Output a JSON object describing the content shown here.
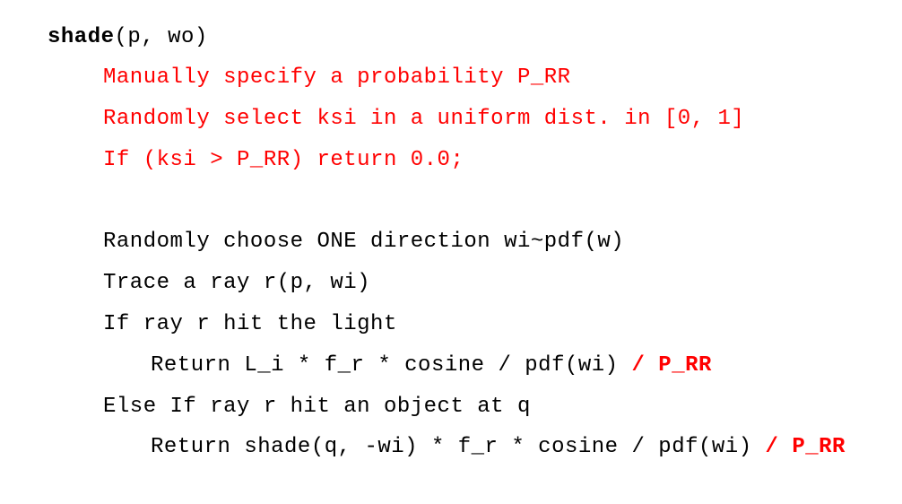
{
  "code": {
    "func_name": "shade",
    "func_args": "(p, wo)",
    "rr_specify": "Manually specify a probability P_RR",
    "rr_select": "Randomly select ksi in a uniform dist. in [0, 1]",
    "rr_if": "If (ksi > P_RR) return 0.0;",
    "choose_dir": "Randomly choose ONE direction wi~pdf(w)",
    "trace_ray": "Trace a ray r(p, wi)",
    "if_light": "If ray r hit the light",
    "return_light": "Return L_i * f_r * cosine / pdf(wi) ",
    "return_light_rr": "/ P_RR",
    "else_if_object": "Else If ray r hit an object at q",
    "return_shade": "Return shade(q, -wi) * f_r * cosine / pdf(wi) ",
    "return_shade_rr": "/ P_RR"
  },
  "colors": {
    "text": "#000000",
    "highlight": "#ff0000",
    "background": "#ffffff"
  }
}
